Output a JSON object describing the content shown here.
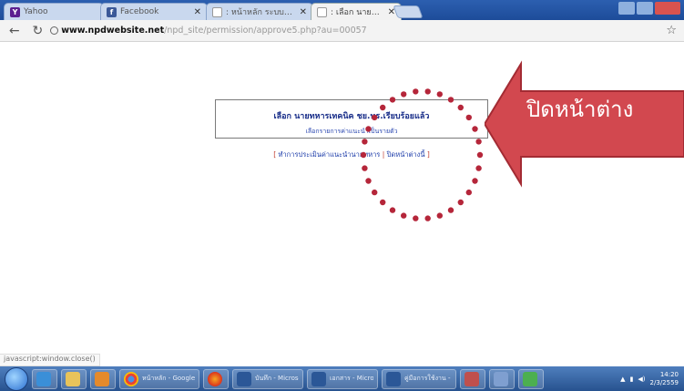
{
  "_note": "The page and tab text in this screenshot is Thai and is rendered too small/blurry to read reliably; the Thai strings below are best-effort approximations rather than exact transcriptions.",
  "tabs": [
    {
      "title": "Yahoo",
      "favicon": "Y"
    },
    {
      "title": "Facebook",
      "favicon": "f"
    },
    {
      "title": ": หน้าหลัก ระบบบริหารงาน",
      "favicon": ""
    },
    {
      "title": ": เลือก นายทหารเทคนิค ชย.",
      "favicon": ""
    }
  ],
  "toolbar": {
    "back_icon": "arrow-left-icon",
    "reload_icon": "reload-icon",
    "url_domain": "www.npdwebsite.net",
    "url_path": "/npd_site/permission/approve5.php?au=00057"
  },
  "page": {
    "dialog_title": "เลือก นายทหารเทคนิค ชย.ทร.เรียบร้อยแล้ว",
    "dialog_subtitle": "เลือกรายการค่าแนะนำเป็นรายตัว",
    "link_open": "[",
    "link_1": "ทำการประเมินค่าแนะนำนายทหาร",
    "link_sep": "|",
    "link_2": "ปิดหน้าต่างนี้",
    "link_close": "]"
  },
  "annotation": {
    "arrow_label": "ปิดหน้าต่าง",
    "arrow_color": "#d2484f",
    "circle_color": "#b5263a"
  },
  "status_bar": {
    "text": "javascript:window.close()"
  },
  "taskbar": {
    "apps": [
      {
        "name": "internet-explorer",
        "label": ""
      },
      {
        "name": "explorer",
        "label": ""
      },
      {
        "name": "media",
        "label": ""
      },
      {
        "name": "chrome",
        "label": "หน้าหลัก - Google..."
      },
      {
        "name": "firefox",
        "label": ""
      },
      {
        "name": "word-1",
        "label": "บันทึก - Microsoft"
      },
      {
        "name": "word-2",
        "label": "เอกสาร - Microsoft"
      },
      {
        "name": "word-3",
        "label": "คู่มือการใช้งาน - M..."
      },
      {
        "name": "app-a",
        "label": ""
      },
      {
        "name": "app-b",
        "label": ""
      },
      {
        "name": "app-c",
        "label": ""
      }
    ],
    "tray_time": "14:20",
    "tray_date": "2/3/2559"
  }
}
